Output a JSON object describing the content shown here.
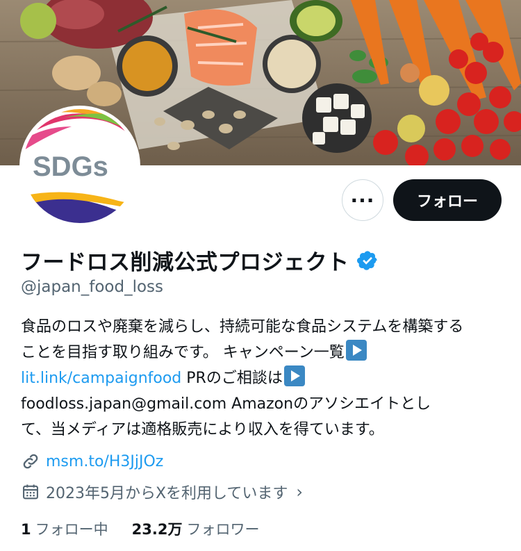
{
  "profile": {
    "display_name": "フードロス削減公式プロジェクト",
    "handle": "@japan_food_loss",
    "avatar_text": "SDGs",
    "bio": {
      "line1": "食品のロスや廃棄を減らし、持続可能な食品システムを構築する",
      "line2": "ことを目指す取り組みです。 キャンペーン一覧",
      "link1": "lit.link/campaignfood",
      "line3_after_link": " PRのご相談は",
      "line4": "foodloss.japan@gmail.com Amazonのアソシエイトとし",
      "line5": "て、当メディアは適格販売により収入を得ています。"
    },
    "website": "msm.to/H3JjJOz",
    "joined": "2023年5月からXを利用しています",
    "following_count": "1",
    "following_label": "フォロー中",
    "followers_count": "23.2万",
    "followers_label": "フォロワー"
  },
  "buttons": {
    "more_label": "···",
    "follow_label": "フォロー"
  },
  "icons": {
    "verified": "verified-badge-icon",
    "link": "link-icon",
    "calendar": "calendar-icon",
    "play": "play-button-icon"
  },
  "colors": {
    "accent": "#1d9bf0",
    "text": "#0f1419",
    "muted": "#536471",
    "follow_bg": "#0f1419"
  }
}
